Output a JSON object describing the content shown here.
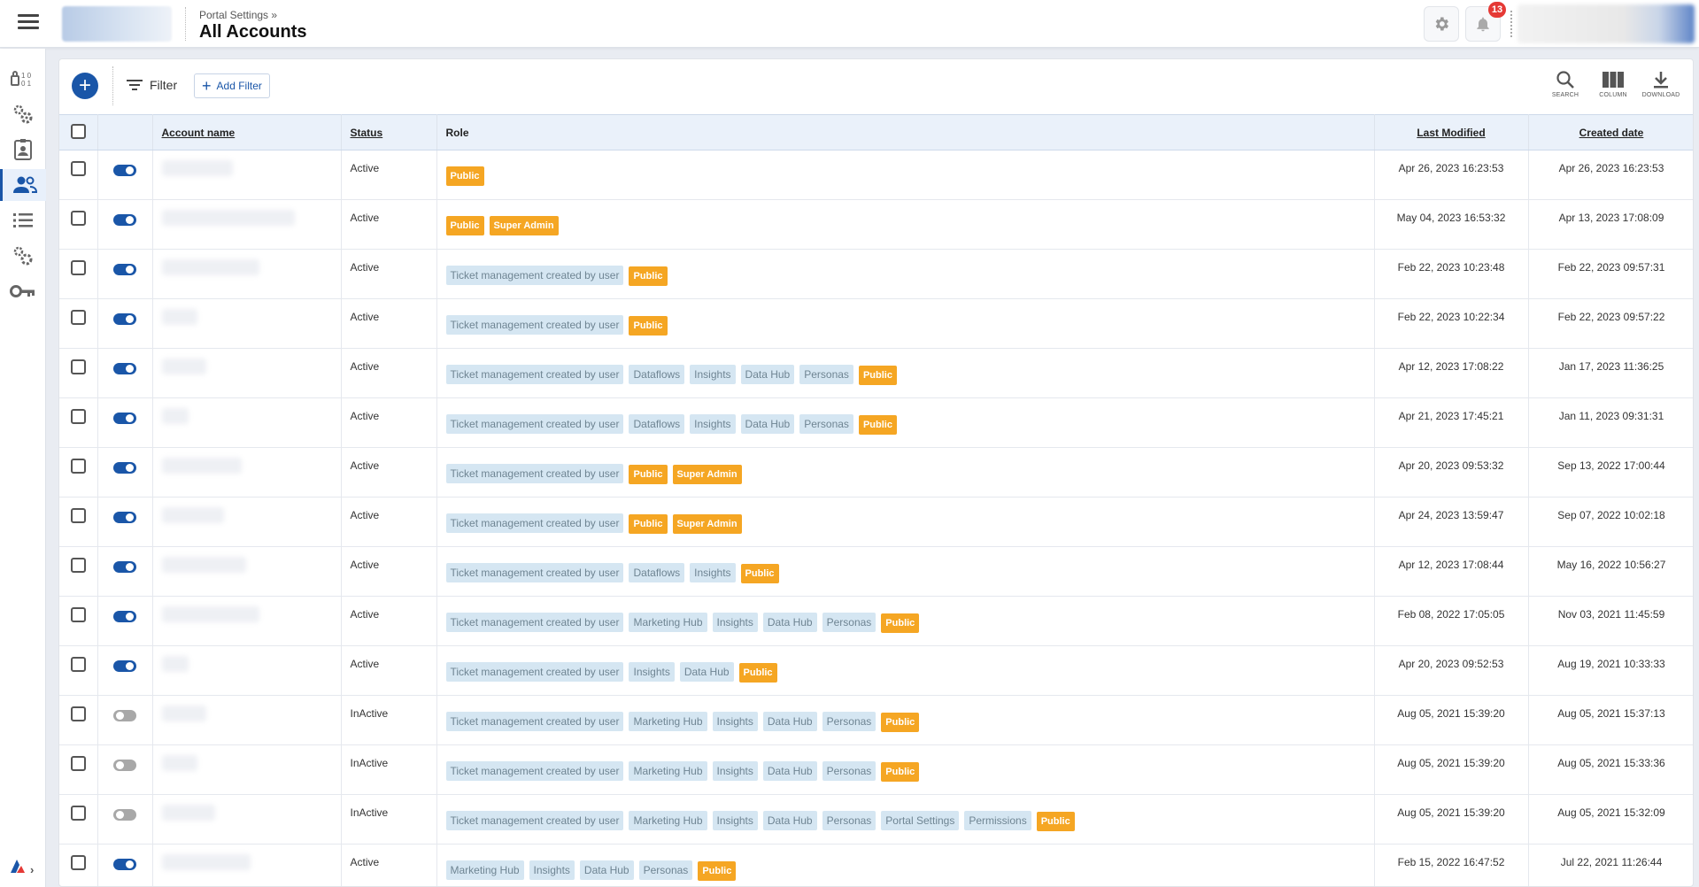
{
  "header": {
    "breadcrumb": "Portal Settings »",
    "title": "All Accounts",
    "notification_count": "13"
  },
  "toolbar": {
    "filter_label": "Filter",
    "add_filter_label": "Add Filter",
    "search_label": "SEARCH",
    "column_label": "COLUMN",
    "download_label": "DOWNLOAD"
  },
  "columns": {
    "account_name": "Account name",
    "status": "Status",
    "role": "Role",
    "last_modified": "Last Modified",
    "created_date": "Created date"
  },
  "rows": [
    {
      "enabled": true,
      "status": "Active",
      "roles": [
        "Public"
      ],
      "last_modified": "Apr 26, 2023 16:23:53",
      "created": "Apr 26, 2023 16:23:53"
    },
    {
      "enabled": true,
      "status": "Active",
      "roles": [
        "Public",
        "Super Admin"
      ],
      "last_modified": "May 04, 2023 16:53:32",
      "created": "Apr 13, 2023 17:08:09"
    },
    {
      "enabled": true,
      "status": "Active",
      "roles": [
        "Ticket management created by user",
        "Public"
      ],
      "last_modified": "Feb 22, 2023 10:23:48",
      "created": "Feb 22, 2023 09:57:31"
    },
    {
      "enabled": true,
      "status": "Active",
      "roles": [
        "Ticket management created by user",
        "Public"
      ],
      "last_modified": "Feb 22, 2023 10:22:34",
      "created": "Feb 22, 2023 09:57:22"
    },
    {
      "enabled": true,
      "status": "Active",
      "roles": [
        "Ticket management created by user",
        "Dataflows",
        "Insights",
        "Data Hub",
        "Personas",
        "Public"
      ],
      "last_modified": "Apr 12, 2023 17:08:22",
      "created": "Jan 17, 2023 11:36:25"
    },
    {
      "enabled": true,
      "status": "Active",
      "roles": [
        "Ticket management created by user",
        "Dataflows",
        "Insights",
        "Data Hub",
        "Personas",
        "Public"
      ],
      "last_modified": "Apr 21, 2023 17:45:21",
      "created": "Jan 11, 2023 09:31:31"
    },
    {
      "enabled": true,
      "status": "Active",
      "roles": [
        "Ticket management created by user",
        "Public",
        "Super Admin"
      ],
      "last_modified": "Apr 20, 2023 09:53:32",
      "created": "Sep 13, 2022 17:00:44"
    },
    {
      "enabled": true,
      "status": "Active",
      "roles": [
        "Ticket management created by user",
        "Public",
        "Super Admin"
      ],
      "last_modified": "Apr 24, 2023 13:59:47",
      "created": "Sep 07, 2022 10:02:18"
    },
    {
      "enabled": true,
      "status": "Active",
      "roles": [
        "Ticket management created by user",
        "Dataflows",
        "Insights",
        "Public"
      ],
      "last_modified": "Apr 12, 2023 17:08:44",
      "created": "May 16, 2022 10:56:27"
    },
    {
      "enabled": true,
      "status": "Active",
      "roles": [
        "Ticket management created by user",
        "Marketing Hub",
        "Insights",
        "Data Hub",
        "Personas",
        "Public"
      ],
      "last_modified": "Feb 08, 2022 17:05:05",
      "created": "Nov 03, 2021 11:45:59"
    },
    {
      "enabled": true,
      "status": "Active",
      "roles": [
        "Ticket management created by user",
        "Insights",
        "Data Hub",
        "Public"
      ],
      "last_modified": "Apr 20, 2023 09:52:53",
      "created": "Aug 19, 2021 10:33:33"
    },
    {
      "enabled": false,
      "status": "InActive",
      "roles": [
        "Ticket management created by user",
        "Marketing Hub",
        "Insights",
        "Data Hub",
        "Personas",
        "Public"
      ],
      "last_modified": "Aug 05, 2021 15:39:20",
      "created": "Aug 05, 2021 15:37:13"
    },
    {
      "enabled": false,
      "status": "InActive",
      "roles": [
        "Ticket management created by user",
        "Marketing Hub",
        "Insights",
        "Data Hub",
        "Personas",
        "Public"
      ],
      "last_modified": "Aug 05, 2021 15:39:20",
      "created": "Aug 05, 2021 15:33:36"
    },
    {
      "enabled": false,
      "status": "InActive",
      "roles": [
        "Ticket management created by user",
        "Marketing Hub",
        "Insights",
        "Data Hub",
        "Personas",
        "Portal Settings",
        "Permissions",
        "Public"
      ],
      "last_modified": "Aug 05, 2021 15:39:20",
      "created": "Aug 05, 2021 15:32:09"
    },
    {
      "enabled": true,
      "status": "Active",
      "roles": [
        "Marketing Hub",
        "Insights",
        "Data Hub",
        "Personas",
        "Public"
      ],
      "last_modified": "Feb 15, 2022 16:47:52",
      "created": "Jul 22, 2021 11:26:44"
    }
  ],
  "colors": {
    "accent": "#1a56a8",
    "public_tag": "#f5a623",
    "role_tag": "#d5e6f2",
    "header_bg": "#eaf1fa"
  },
  "icons": {
    "rail": [
      "binary-data-icon",
      "gears-icon",
      "contact-card-icon",
      "users-icon",
      "list-icon",
      "settings-icon",
      "key-icon"
    ]
  }
}
